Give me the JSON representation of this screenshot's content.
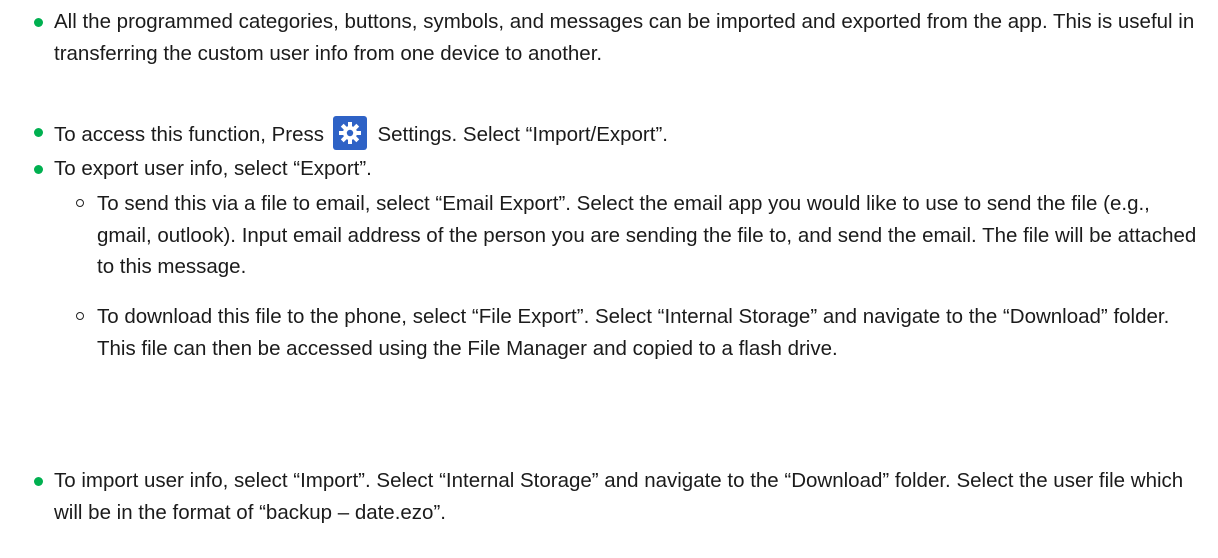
{
  "colors": {
    "bullet": "#00b050",
    "gear_bg": "#2e62c6"
  },
  "bullets": [
    {
      "text": "All the programmed categories, buttons, symbols, and messages can be imported and exported from the app. This is useful in transferring the custom user info from one device to another."
    },
    {
      "text_before": "To access this function, Press",
      "icon": "gear-icon",
      "text_after": "Settings. Select “Import/Export”."
    },
    {
      "text": "To export user info, select “Export”.",
      "sub": [
        {
          "text": "To send this via a file to email, select “Email Export”. Select the email app you would like to use to send the file (e.g., gmail, outlook). Input email address of the person you are sending the file to, and send the email. The file will be attached to this message."
        },
        {
          "text": "To download this file to the phone, select “File Export”. Select “Internal Storage” and navigate to the “Download” folder. This file can then be accessed using the File Manager and copied to a flash drive."
        }
      ]
    },
    {
      "text": "To import user info, select “Import”. Select “Internal Storage” and navigate to the “Download” folder. Select the user file which will be in the format of “backup – date.ezo”."
    }
  ]
}
